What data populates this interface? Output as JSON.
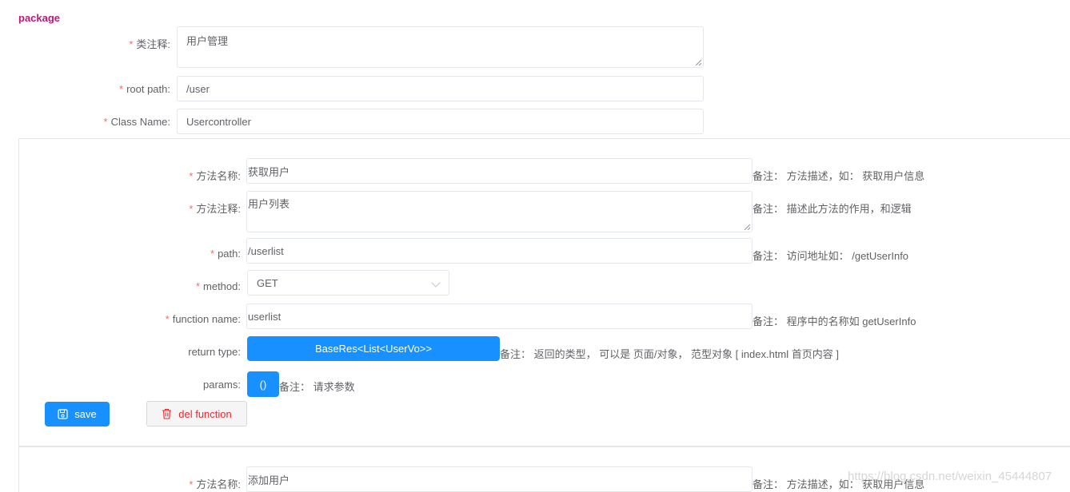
{
  "package": {
    "title": "package",
    "class_comment": {
      "label": "类注释:",
      "value": "用户管理"
    },
    "root_path": {
      "label": "root path:",
      "value": "/user"
    },
    "class_name": {
      "label": "Class Name:",
      "value": "Usercontroller"
    }
  },
  "methods": [
    {
      "name": {
        "label": "方法名称:",
        "value": "获取用户",
        "note": "备注： 方法描述，如： 获取用户信息"
      },
      "comment": {
        "label": "方法注释:",
        "value": "用户列表",
        "note": "备注： 描述此方法的作用，和逻辑"
      },
      "path": {
        "label": "path:",
        "value": "/userlist",
        "note": "备注： 访问地址如： /getUserInfo"
      },
      "method": {
        "label": "method:",
        "value": "GET"
      },
      "function_name": {
        "label": "function name:",
        "value": "userlist",
        "note": "备注： 程序中的名称如 getUserInfo"
      },
      "return_type": {
        "label": "return type:",
        "value": "BaseRes<List<UserVo>>",
        "note": "备注： 返回的类型， 可以是 页面/对象， 范型对象 [ index.html 首页内容 ]"
      },
      "params": {
        "label": "params:",
        "value": "()",
        "note": "备注： 请求参数"
      },
      "save_label": "save",
      "del_label": "del function"
    },
    {
      "name": {
        "label": "方法名称:",
        "value": "添加用户",
        "note": "备注： 方法描述，如： 获取用户信息"
      }
    }
  ],
  "watermark": "https://blog.csdn.net/weixin_45444807",
  "colors": {
    "accent": "#1890ff",
    "required": "#f56c6c",
    "package_title": "#c0157a",
    "danger": "#f5222d"
  },
  "icons": {
    "save": "save-icon",
    "delete": "trash-icon",
    "select": "chevron-down-icon"
  }
}
